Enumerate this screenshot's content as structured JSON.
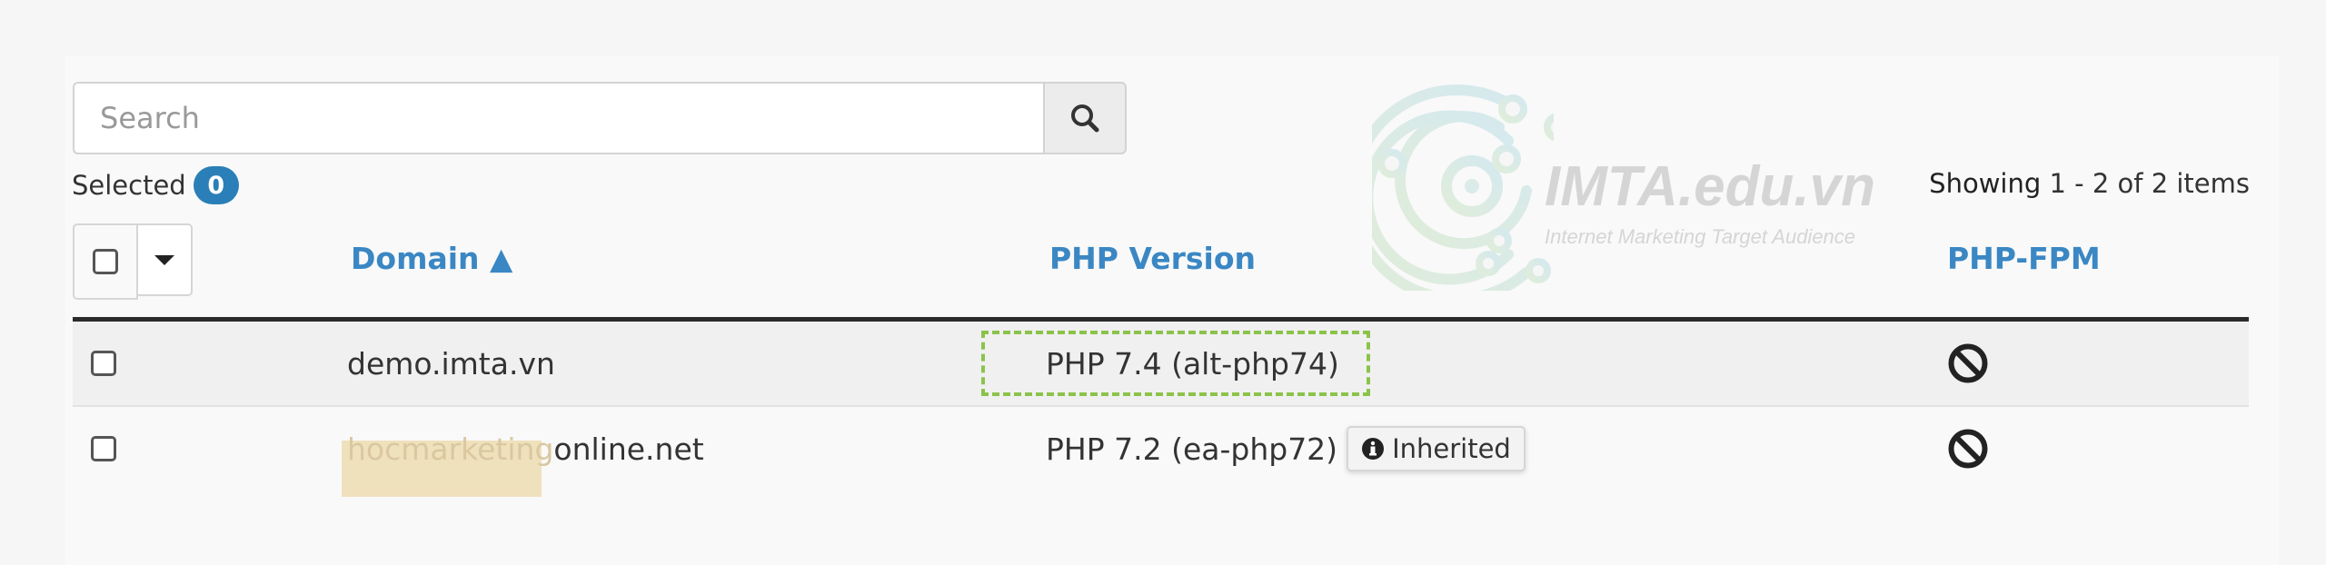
{
  "search": {
    "placeholder": "Search",
    "value": "",
    "button_icon": "search-icon"
  },
  "selection": {
    "label": "Selected",
    "count": "0"
  },
  "pagination": {
    "label": "Showing",
    "range": "1 - 2 of 2 items"
  },
  "table": {
    "columns": [
      {
        "label": "Domain",
        "sort_indicator": "▲",
        "sorted": "ascending"
      },
      {
        "label": "PHP Version"
      },
      {
        "label": "PHP-FPM"
      }
    ],
    "rows": [
      {
        "domain": "demo.imta.vn",
        "php_version": "PHP 7.4 (alt-php74)",
        "php_fpm_icon": "ban-icon",
        "focused": true,
        "checked": false
      },
      {
        "domain_redacted_part": "hocmarketing",
        "domain_visible_part": "online.net",
        "php_version": "PHP 7.2 (ea-php72)",
        "badge": "Inherited",
        "badge_icon": "info-icon",
        "php_fpm_icon": "ban-icon",
        "checked": false
      }
    ]
  },
  "watermark": {
    "title": "IMTA.edu.vn",
    "subtitle": "Internet Marketing Target Audience"
  },
  "colors": {
    "accent": "#3a87c4",
    "badge": "#2a7fb8",
    "focus": "#8bc34a",
    "rule": "#2b2b2b"
  }
}
